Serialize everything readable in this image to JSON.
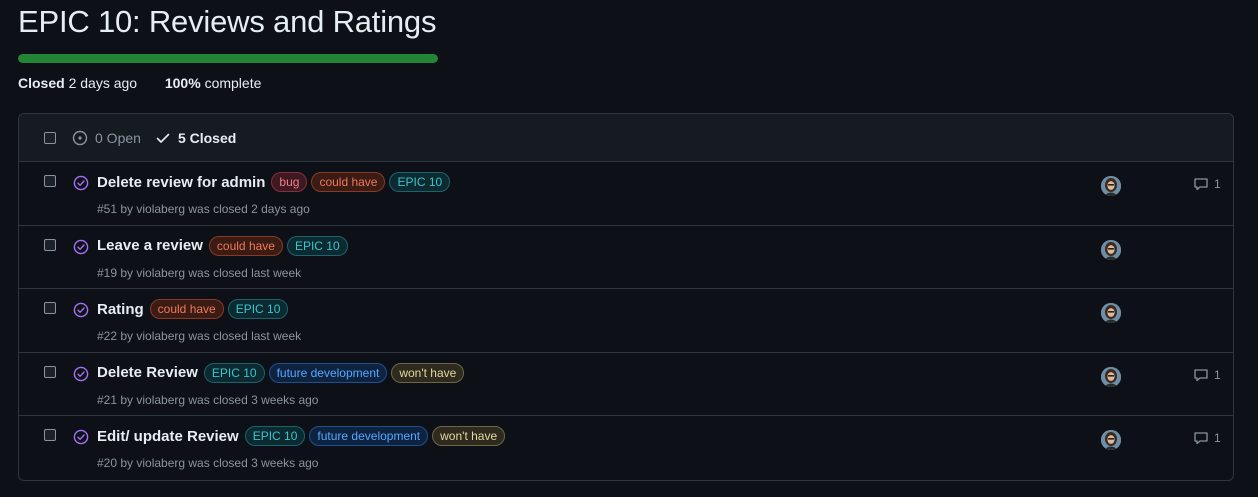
{
  "milestone": {
    "title": "EPIC 10: Reviews and Ratings",
    "progress_percent": 100,
    "status_label": "Closed",
    "closed_when": "2 days ago",
    "percent_label": "100%",
    "complete_label": "complete"
  },
  "filters": {
    "open_label": "0 Open",
    "closed_label": "5 Closed"
  },
  "colors": {
    "progress_green": "#238636",
    "closed_purple": "#a371f7"
  },
  "issues": [
    {
      "title": "Delete review for admin",
      "labels": [
        {
          "text": "bug",
          "fg": "#f47c86",
          "bg": "#3d1a22",
          "border": "#8b2c3a"
        },
        {
          "text": "could have",
          "fg": "#f0785a",
          "bg": "#3a1c14",
          "border": "#8a3a24"
        },
        {
          "text": "EPIC 10",
          "fg": "#39c5cf",
          "bg": "#0c2a30",
          "border": "#1a6470"
        }
      ],
      "meta": "#51 by violaberg was closed 2 days ago",
      "comments": "1"
    },
    {
      "title": "Leave a review",
      "labels": [
        {
          "text": "could have",
          "fg": "#f0785a",
          "bg": "#3a1c14",
          "border": "#8a3a24"
        },
        {
          "text": "EPIC 10",
          "fg": "#39c5cf",
          "bg": "#0c2a30",
          "border": "#1a6470"
        }
      ],
      "meta": "#19 by violaberg was closed last week",
      "comments": ""
    },
    {
      "title": "Rating",
      "labels": [
        {
          "text": "could have",
          "fg": "#f0785a",
          "bg": "#3a1c14",
          "border": "#8a3a24"
        },
        {
          "text": "EPIC 10",
          "fg": "#39c5cf",
          "bg": "#0c2a30",
          "border": "#1a6470"
        }
      ],
      "meta": "#22 by violaberg was closed last week",
      "comments": ""
    },
    {
      "title": "Delete Review",
      "labels": [
        {
          "text": "EPIC 10",
          "fg": "#39c5cf",
          "bg": "#0c2a30",
          "border": "#1a6470"
        },
        {
          "text": "future development",
          "fg": "#58a6ff",
          "bg": "#0e2340",
          "border": "#1f4f8f"
        },
        {
          "text": "won't have",
          "fg": "#e3d6a0",
          "bg": "#2e2b1e",
          "border": "#6d6642"
        }
      ],
      "meta": "#21 by violaberg was closed 3 weeks ago",
      "comments": "1"
    },
    {
      "title": "Edit/ update Review",
      "labels": [
        {
          "text": "EPIC 10",
          "fg": "#39c5cf",
          "bg": "#0c2a30",
          "border": "#1a6470"
        },
        {
          "text": "future development",
          "fg": "#58a6ff",
          "bg": "#0e2340",
          "border": "#1f4f8f"
        },
        {
          "text": "won't have",
          "fg": "#e3d6a0",
          "bg": "#2e2b1e",
          "border": "#6d6642"
        }
      ],
      "meta": "#20 by violaberg was closed 3 weeks ago",
      "comments": "1"
    }
  ]
}
